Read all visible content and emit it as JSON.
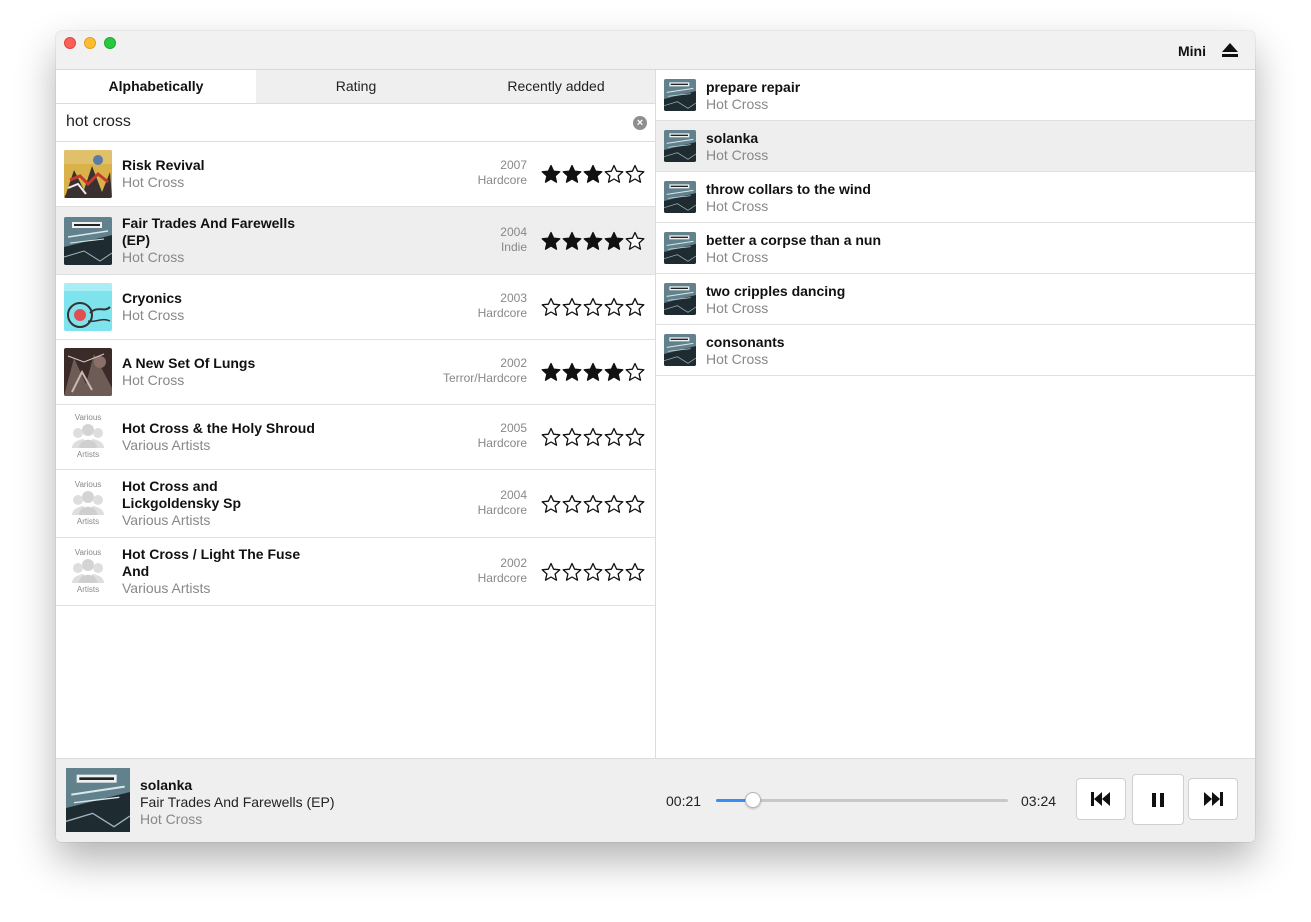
{
  "window": {
    "mini_label": "Mini"
  },
  "tabs": [
    {
      "label": "Alphabetically",
      "active": true
    },
    {
      "label": "Rating",
      "active": false
    },
    {
      "label": "Recently added",
      "active": false
    }
  ],
  "search": {
    "value": "hot cross"
  },
  "albums": [
    {
      "title_lines": [
        "Risk Revival"
      ],
      "artist": "Hot Cross",
      "year": "2007",
      "genre": "Hardcore",
      "rating": 3,
      "cover": "risk-revival-cover"
    },
    {
      "title_lines": [
        "Fair Trades And Farewells",
        "(EP)"
      ],
      "artist": "Hot Cross",
      "year": "2004",
      "genre": "Indie",
      "rating": 4,
      "cover": "fair-trades-cover",
      "selected": true
    },
    {
      "title_lines": [
        "Cryonics"
      ],
      "artist": "Hot Cross",
      "year": "2003",
      "genre": "Hardcore",
      "rating": 0,
      "cover": "cryonics-cover"
    },
    {
      "title_lines": [
        "A New Set Of Lungs"
      ],
      "artist": "Hot Cross",
      "year": "2002",
      "genre": "Terror/Hardcore",
      "rating": 4,
      "cover": "new-set-of-lungs-cover"
    },
    {
      "title_lines": [
        "Hot Cross & the Holy Shroud"
      ],
      "artist": "Various Artists",
      "year": "2005",
      "genre": "Hardcore",
      "rating": 0,
      "cover": "various-artists-cover"
    },
    {
      "title_lines": [
        "Hot Cross and",
        "Lickgoldensky Sp"
      ],
      "artist": "Various Artists",
      "year": "2004",
      "genre": "Hardcore",
      "rating": 0,
      "cover": "various-artists-cover"
    },
    {
      "title_lines": [
        "Hot Cross / Light The Fuse",
        "And"
      ],
      "artist": "Various Artists",
      "year": "2002",
      "genre": "Hardcore",
      "rating": 0,
      "cover": "various-artists-cover"
    }
  ],
  "various_cover_text": {
    "top": "Various",
    "bottom": "Artists"
  },
  "tracks": [
    {
      "title": "prepare repair",
      "artist": "Hot Cross"
    },
    {
      "title": "solanka",
      "artist": "Hot Cross",
      "selected": true
    },
    {
      "title": "throw collars to the wind",
      "artist": "Hot Cross"
    },
    {
      "title": "better a corpse than a nun",
      "artist": "Hot Cross"
    },
    {
      "title": "two cripples dancing",
      "artist": "Hot Cross"
    },
    {
      "title": "consonants",
      "artist": "Hot Cross"
    }
  ],
  "player": {
    "title": "solanka",
    "album": "Fair Trades And Farewells (EP)",
    "artist": "Hot Cross",
    "elapsed": "00:21",
    "total": "03:24",
    "progress": 0.127
  },
  "colors": {
    "accent": "#3b8cf5",
    "selected_row": "#eeeeee",
    "secondary_text": "#888888"
  }
}
